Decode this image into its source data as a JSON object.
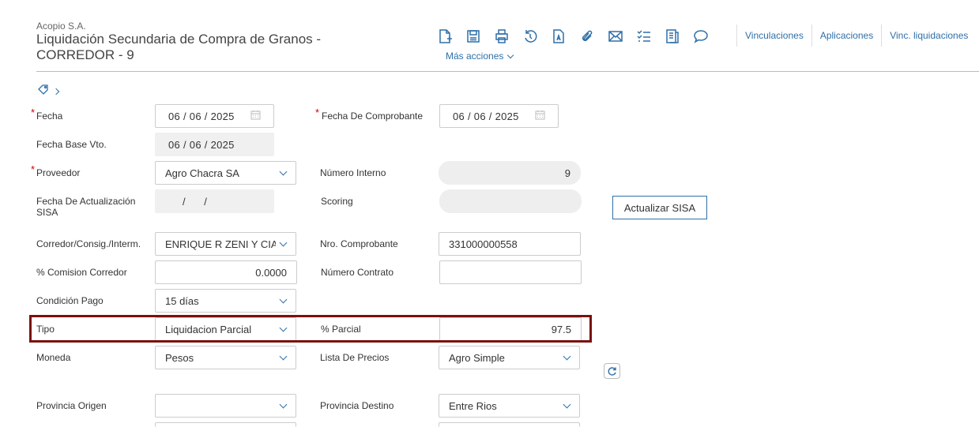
{
  "header": {
    "company": "Acopio S.A.",
    "title": "Liquidación Secundaria de Compra de Granos - CORREDOR - 9"
  },
  "toolbar": {
    "icons": [
      "new-document-icon",
      "save-icon",
      "print-icon",
      "history-icon",
      "text-document-icon",
      "attachment-icon",
      "mail-icon",
      "checklist-icon",
      "notes-icon",
      "comment-icon"
    ],
    "links": [
      "Vinculaciones",
      "Aplicaciones",
      "Vinc. liquidaciones"
    ],
    "more_actions": "Más acciones"
  },
  "form": {
    "fecha": {
      "label": "Fecha",
      "value": "06 / 06 / 2025"
    },
    "fecha_comprobante": {
      "label": "Fecha De Comprobante",
      "value": "06 / 06 / 2025"
    },
    "fecha_base_vto": {
      "label": "Fecha Base Vto.",
      "value": "06 / 06 / 2025"
    },
    "proveedor": {
      "label": "Proveedor",
      "value": "Agro Chacra SA"
    },
    "numero_interno": {
      "label": "Número Interno",
      "value": "9"
    },
    "fecha_actualizacion_sisa": {
      "label": "Fecha De Actualización SISA",
      "value": "/ /"
    },
    "scoring": {
      "label": "Scoring",
      "value": ""
    },
    "actualizar_sisa": "Actualizar SISA",
    "corredor": {
      "label": "Corredor/Consig./Interm.",
      "value": "ENRIQUE R ZENI Y CIA"
    },
    "nro_comprobante": {
      "label": "Nro. Comprobante",
      "value": "331000000558"
    },
    "comision_corredor": {
      "label": "% Comision Corredor",
      "value": "0.0000"
    },
    "numero_contrato": {
      "label": "Número Contrato",
      "value": ""
    },
    "condicion_pago": {
      "label": "Condición Pago",
      "value": "15 días"
    },
    "tipo": {
      "label": "Tipo",
      "value": "Liquidacion Parcial"
    },
    "parcial": {
      "label": "% Parcial",
      "value": "97.5"
    },
    "moneda": {
      "label": "Moneda",
      "value": "Pesos"
    },
    "lista_precios": {
      "label": "Lista De Precios",
      "value": "Agro Simple"
    },
    "provincia_origen": {
      "label": "Provincia Origen",
      "value": ""
    },
    "provincia_destino": {
      "label": "Provincia Destino",
      "value": "Entre Rios"
    }
  },
  "colors": {
    "accent": "#2f6fa8",
    "highlight_border": "#7a1010",
    "required": "#cc0000"
  }
}
